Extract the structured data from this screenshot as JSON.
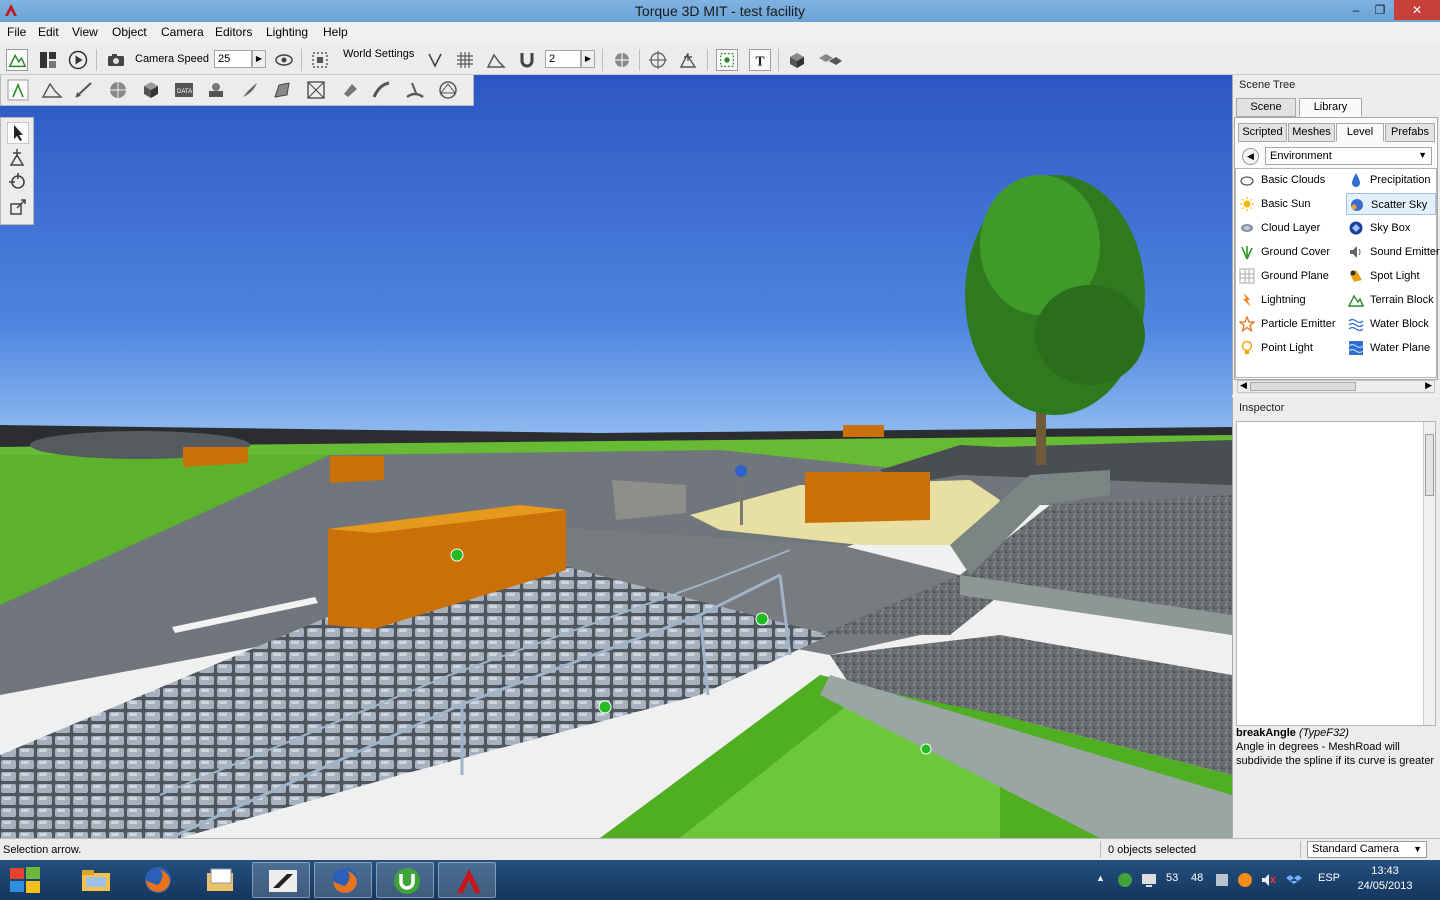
{
  "window": {
    "title": "Torque 3D MIT - test facility",
    "minimize": "–",
    "maximize": "❐",
    "close": "✕"
  },
  "menu": [
    "File",
    "Edit",
    "View",
    "Object",
    "Camera",
    "Editors",
    "Lighting",
    "Help"
  ],
  "toolbar": {
    "camera_speed_label": "Camera Speed",
    "camera_speed_value": "25",
    "world_settings_label": "World Settings",
    "snap_value": "2",
    "spin": "▶"
  },
  "scene_tree": {
    "title": "Scene Tree",
    "tabs": [
      "Scene",
      "Library"
    ],
    "active_tab": "Library",
    "library_tabs": [
      "Scripted",
      "Meshes",
      "Level",
      "Prefabs"
    ],
    "active_library_tab": "Level",
    "category": "Environment",
    "back": "◀",
    "dropdown_arrow": "▼",
    "items_left": [
      "Basic Clouds",
      "Basic Sun",
      "Cloud Layer",
      "Ground Cover",
      "Ground Plane",
      "Lightning",
      "Particle Emitter",
      "Point Light"
    ],
    "items_right": [
      "Precipitation",
      "Scatter Sky",
      "Sky Box",
      "Sound Emitter",
      "Spot Light",
      "Terrain Block",
      "Water Block",
      "Water Plane"
    ],
    "selected_item": "Scatter Sky",
    "scroll_left": "◀",
    "scroll_right": "▶"
  },
  "inspector": {
    "title": "Inspector",
    "help_name": "breakAngle",
    "help_type": "(TypeF32)",
    "help_text": "Angle in degrees - MeshRoad will subdivide the spline if its curve is greater"
  },
  "status": {
    "message": "Selection arrow.",
    "selection": "0 objects selected",
    "camera_mode": "Standard Camera",
    "dropdown_arrow": "▼"
  },
  "taskbar": {
    "tray_values": [
      "53",
      "48"
    ],
    "language": "ESP",
    "time": "13:43",
    "date": "24/05/2013",
    "show_hidden": "▲"
  },
  "colors": {
    "sky": "#3a6ad0",
    "grass": "#5fb52a",
    "asphalt": "#6f757b",
    "orange_block": "#d47a05",
    "taskbar": "#1b3f6a"
  }
}
